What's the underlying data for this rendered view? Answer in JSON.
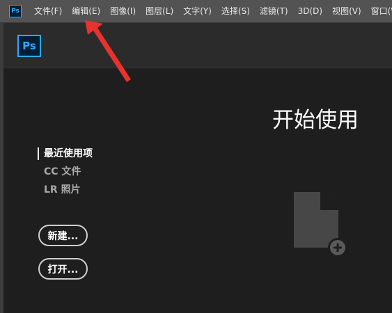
{
  "menubar": {
    "app_icon": "Ps",
    "items": [
      {
        "label": "文件(F)"
      },
      {
        "label": "编辑(E)"
      },
      {
        "label": "图像(I)"
      },
      {
        "label": "图层(L)"
      },
      {
        "label": "文字(Y)"
      },
      {
        "label": "选择(S)"
      },
      {
        "label": "滤镜(T)"
      },
      {
        "label": "3D(D)"
      },
      {
        "label": "视图(V)"
      },
      {
        "label": "窗口(W"
      }
    ]
  },
  "toolbar": {
    "app_icon": "Ps"
  },
  "start": {
    "title": "开始使用",
    "nav": [
      {
        "label": "最近使用项",
        "active": true
      },
      {
        "label": "CC 文件",
        "active": false
      },
      {
        "label": "LR 照片",
        "active": false
      }
    ],
    "new_button": "新建...",
    "open_button": "打开..."
  },
  "colors": {
    "menubar_bg": "#535353",
    "toolbar_bg": "#2b2b2b",
    "main_bg": "#1e1e1e",
    "ps_blue": "#31a8ff",
    "ps_dark": "#001e36",
    "annotation_arrow": "#e8322e"
  },
  "icons": {
    "app": "photoshop-logo-icon",
    "file": "new-file-plus-icon",
    "annotation": "red-arrow-icon"
  }
}
